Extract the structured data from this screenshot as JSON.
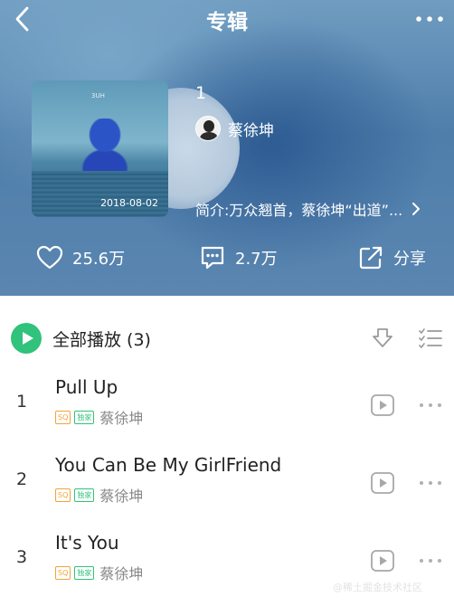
{
  "header": {
    "title": "专辑",
    "back_icon": "chevron-left-icon",
    "more_icon": "more-dots-icon"
  },
  "album": {
    "cover_text": "3UH",
    "date": "2018-08-02",
    "name": "1",
    "artist": "蔡徐坤",
    "intro": "简介:万众翘首，蔡徐坤“出道”..."
  },
  "actions": {
    "like_count": "25.6万",
    "comment_count": "2.7万",
    "share_label": "分享"
  },
  "toolbar": {
    "play_all_label": "全部播放 (3)"
  },
  "songs": [
    {
      "index": "1",
      "title": "Pull Up",
      "tag_sq": "SQ",
      "tag_exclusive": "独家",
      "artist": "蔡徐坤"
    },
    {
      "index": "2",
      "title": "You Can Be My GirlFriend",
      "tag_sq": "SQ",
      "tag_exclusive": "独家",
      "artist": "蔡徐坤"
    },
    {
      "index": "3",
      "title": "It's You",
      "tag_sq": "SQ",
      "tag_exclusive": "独家",
      "artist": "蔡徐坤"
    }
  ],
  "watermark": "@稀土掘金技术社区",
  "colors": {
    "accent_green": "#31c27c",
    "sq_orange": "#f3a338",
    "header_blue": "#4f7eab"
  }
}
